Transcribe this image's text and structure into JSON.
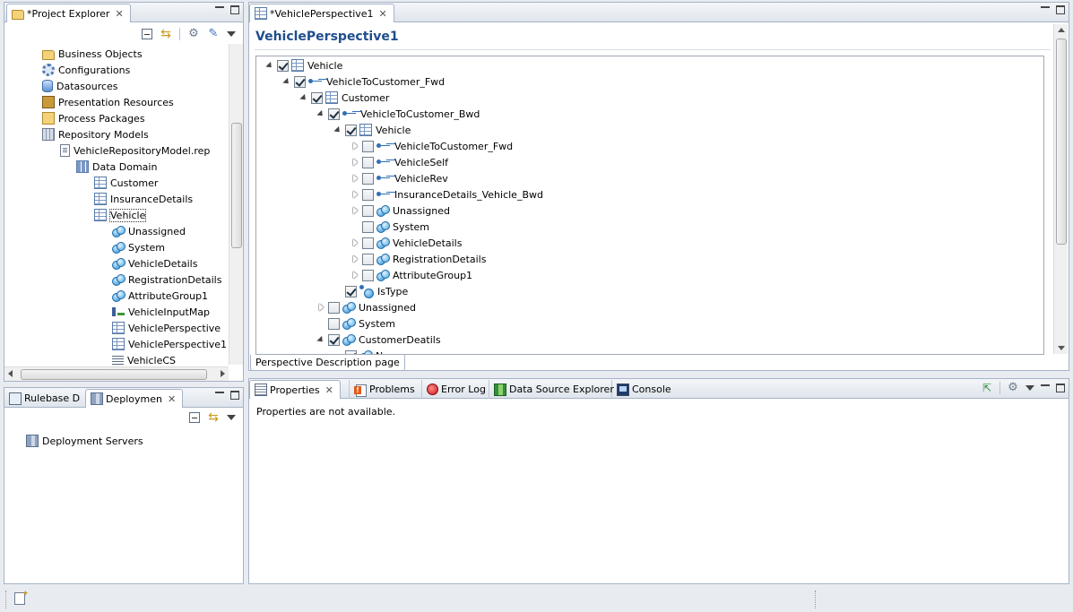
{
  "project_explorer": {
    "tab_label": "*Project Explorer",
    "items": [
      {
        "label": "Business Objects",
        "icon": "folder-icon"
      },
      {
        "label": "Configurations",
        "icon": "gear-icon"
      },
      {
        "label": "Datasources",
        "icon": "database-icon"
      },
      {
        "label": "Presentation Resources",
        "icon": "presentation-icon"
      },
      {
        "label": "Process Packages",
        "icon": "package-icon"
      },
      {
        "label": "Repository Models",
        "icon": "repository-icon"
      },
      {
        "label": "VehicleRepositoryModel.rep",
        "icon": "file-icon"
      },
      {
        "label": "Data Domain",
        "icon": "domain-icon"
      },
      {
        "label": "Customer",
        "icon": "table-icon"
      },
      {
        "label": "InsuranceDetails",
        "icon": "table-icon"
      },
      {
        "label": "Vehicle",
        "icon": "table-icon"
      },
      {
        "label": "Unassigned",
        "icon": "attribute-group-icon"
      },
      {
        "label": "System",
        "icon": "attribute-group-icon"
      },
      {
        "label": "VehicleDetails",
        "icon": "attribute-group-icon"
      },
      {
        "label": "RegistrationDetails",
        "icon": "attribute-group-icon"
      },
      {
        "label": "AttributeGroup1",
        "icon": "attribute-group-icon"
      },
      {
        "label": "VehicleInputMap",
        "icon": "map-icon"
      },
      {
        "label": "VehiclePerspective",
        "icon": "table-icon"
      },
      {
        "label": "VehiclePerspective1",
        "icon": "table-icon"
      },
      {
        "label": "VehicleCS",
        "icon": "list-icon"
      }
    ]
  },
  "deployment": {
    "tab_rulebase": "Rulebase D",
    "tab_deployment": "Deploymen",
    "items": [
      {
        "label": "Deployment Servers",
        "icon": "server-icon"
      }
    ]
  },
  "editor": {
    "tab_label": "*VehiclePerspective1",
    "heading": "VehiclePerspective1",
    "bottom_tab": "Perspective Description page",
    "tree": [
      {
        "label": "Vehicle",
        "checked": true,
        "twisty": "open",
        "icon": "table-icon"
      },
      {
        "label": "VehicleToCustomer_Fwd",
        "checked": true,
        "twisty": "open",
        "icon": "relation-icon"
      },
      {
        "label": "Customer",
        "checked": true,
        "twisty": "open",
        "icon": "table-icon"
      },
      {
        "label": "VehicleToCustomer_Bwd",
        "checked": true,
        "twisty": "open",
        "icon": "relation-icon"
      },
      {
        "label": "Vehicle",
        "checked": true,
        "twisty": "open",
        "icon": "table-icon"
      },
      {
        "label": "VehicleToCustomer_Fwd",
        "checked": false,
        "twisty": "closed",
        "icon": "relation-icon"
      },
      {
        "label": "VehicleSelf",
        "checked": false,
        "twisty": "closed",
        "icon": "relation-icon"
      },
      {
        "label": "VehicleRev",
        "checked": false,
        "twisty": "closed",
        "icon": "relation-icon"
      },
      {
        "label": "InsuranceDetails_Vehicle_Bwd",
        "checked": false,
        "twisty": "closed",
        "icon": "relation-icon"
      },
      {
        "label": "Unassigned",
        "checked": false,
        "twisty": "closed",
        "icon": "attribute-group-icon"
      },
      {
        "label": "System",
        "checked": false,
        "twisty": "none",
        "icon": "attribute-group-icon"
      },
      {
        "label": "VehicleDetails",
        "checked": false,
        "twisty": "closed",
        "icon": "attribute-group-icon"
      },
      {
        "label": "RegistrationDetails",
        "checked": false,
        "twisty": "closed",
        "icon": "attribute-group-icon"
      },
      {
        "label": "AttributeGroup1",
        "checked": false,
        "twisty": "closed",
        "icon": "attribute-group-icon"
      },
      {
        "label": "IsType",
        "checked": true,
        "twisty": "none",
        "icon": "istype-icon"
      },
      {
        "label": "Unassigned",
        "checked": false,
        "twisty": "closed",
        "icon": "attribute-group-icon"
      },
      {
        "label": "System",
        "checked": false,
        "twisty": "none",
        "icon": "attribute-group-icon"
      },
      {
        "label": "CustomerDeatils",
        "checked": true,
        "twisty": "open",
        "icon": "attribute-group-icon"
      },
      {
        "label": "Name",
        "checked": true,
        "twisty": "none",
        "icon": "attribute-icon"
      }
    ]
  },
  "bottom_panel": {
    "tabs": [
      {
        "label": "Properties",
        "icon": "properties-icon"
      },
      {
        "label": "Problems",
        "icon": "problems-icon"
      },
      {
        "label": "Error Log",
        "icon": "error-log-icon"
      },
      {
        "label": "Data Source Explorer",
        "icon": "data-source-explorer-icon"
      },
      {
        "label": "Console",
        "icon": "console-icon"
      }
    ],
    "message": "Properties are not available."
  },
  "colors": {
    "heading": "#1f4e8c",
    "border": "#a6b3c6",
    "selection": "#3399ff"
  }
}
